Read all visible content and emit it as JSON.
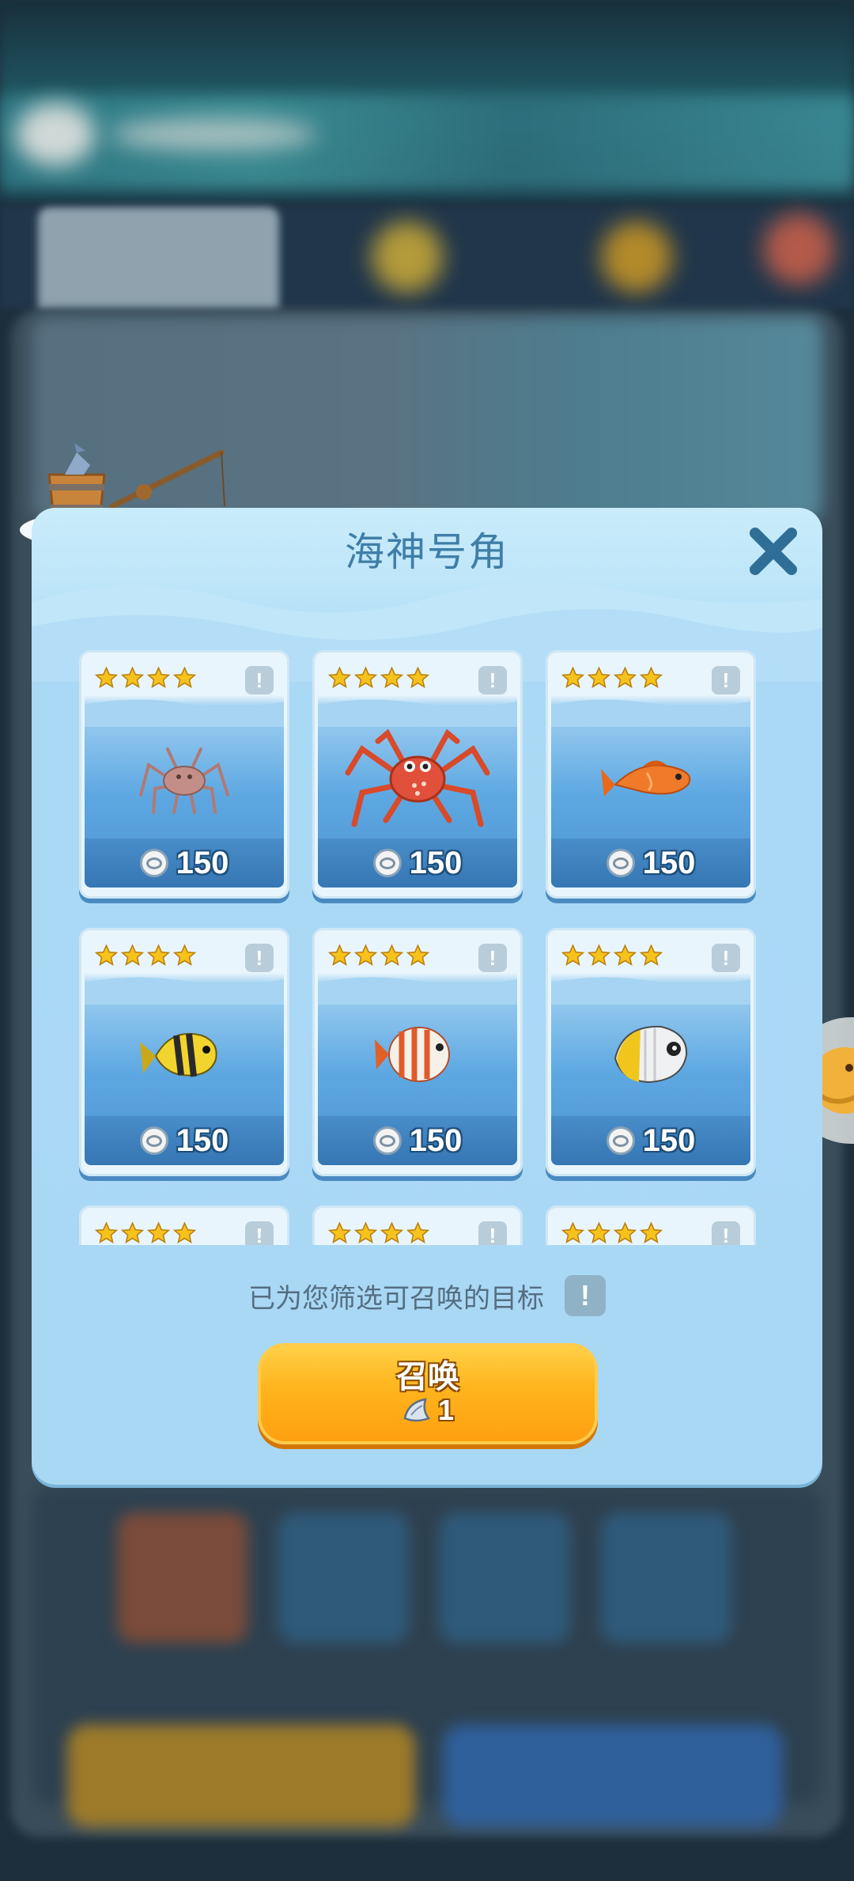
{
  "dialog": {
    "title": "海神号角",
    "filter_hint": "已为您筛选可召唤的目标",
    "summon": {
      "label": "召唤",
      "cost": "1"
    }
  },
  "cards": [
    {
      "stars": 4,
      "price": "150",
      "creature": "sea-spider-icon"
    },
    {
      "stars": 4,
      "price": "150",
      "creature": "red-crab-icon"
    },
    {
      "stars": 4,
      "price": "150",
      "creature": "orange-fish-icon"
    },
    {
      "stars": 4,
      "price": "150",
      "creature": "yellow-black-fish-icon"
    },
    {
      "stars": 4,
      "price": "150",
      "creature": "striped-red-fish-icon"
    },
    {
      "stars": 4,
      "price": "150",
      "creature": "butterflyfish-icon"
    },
    {
      "stars": 4,
      "price": "",
      "creature": ""
    },
    {
      "stars": 4,
      "price": "",
      "creature": ""
    },
    {
      "stars": 4,
      "price": "",
      "creature": ""
    }
  ],
  "colors": {
    "accent": "#ffb41d",
    "title": "#3f7ea8",
    "star": "#f7c21c"
  }
}
